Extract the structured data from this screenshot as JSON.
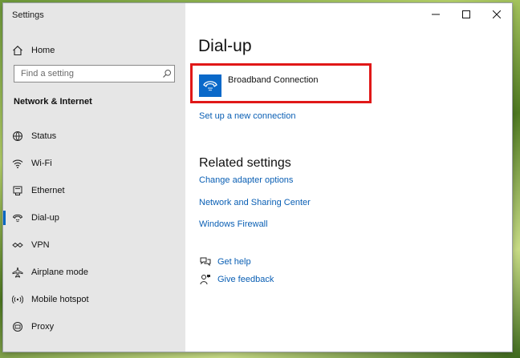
{
  "window": {
    "title": "Settings"
  },
  "sidebar": {
    "home_label": "Home",
    "search_placeholder": "Find a setting",
    "section_heading": "Network & Internet",
    "items": [
      {
        "label": "Status",
        "icon": "globe-icon"
      },
      {
        "label": "Wi-Fi",
        "icon": "wifi-icon"
      },
      {
        "label": "Ethernet",
        "icon": "ethernet-icon"
      },
      {
        "label": "Dial-up",
        "icon": "dialup-phone-icon",
        "active": true
      },
      {
        "label": "VPN",
        "icon": "vpn-icon"
      },
      {
        "label": "Airplane mode",
        "icon": "airplane-icon"
      },
      {
        "label": "Mobile hotspot",
        "icon": "hotspot-icon"
      },
      {
        "label": "Proxy",
        "icon": "proxy-icon"
      }
    ]
  },
  "main": {
    "title": "Dial-up",
    "connection": {
      "label": "Broadband Connection",
      "icon": "dialup-phone-icon"
    },
    "setup_link": "Set up a new connection",
    "related_heading": "Related settings",
    "related_links": [
      "Change adapter options",
      "Network and Sharing Center",
      "Windows Firewall"
    ],
    "help": {
      "get_help": "Get help",
      "give_feedback": "Give feedback"
    }
  },
  "colors": {
    "accent": "#0a69c9",
    "link": "#0a5fb4",
    "highlight": "#e01818",
    "sidebar_bg": "#e6e6e6"
  }
}
